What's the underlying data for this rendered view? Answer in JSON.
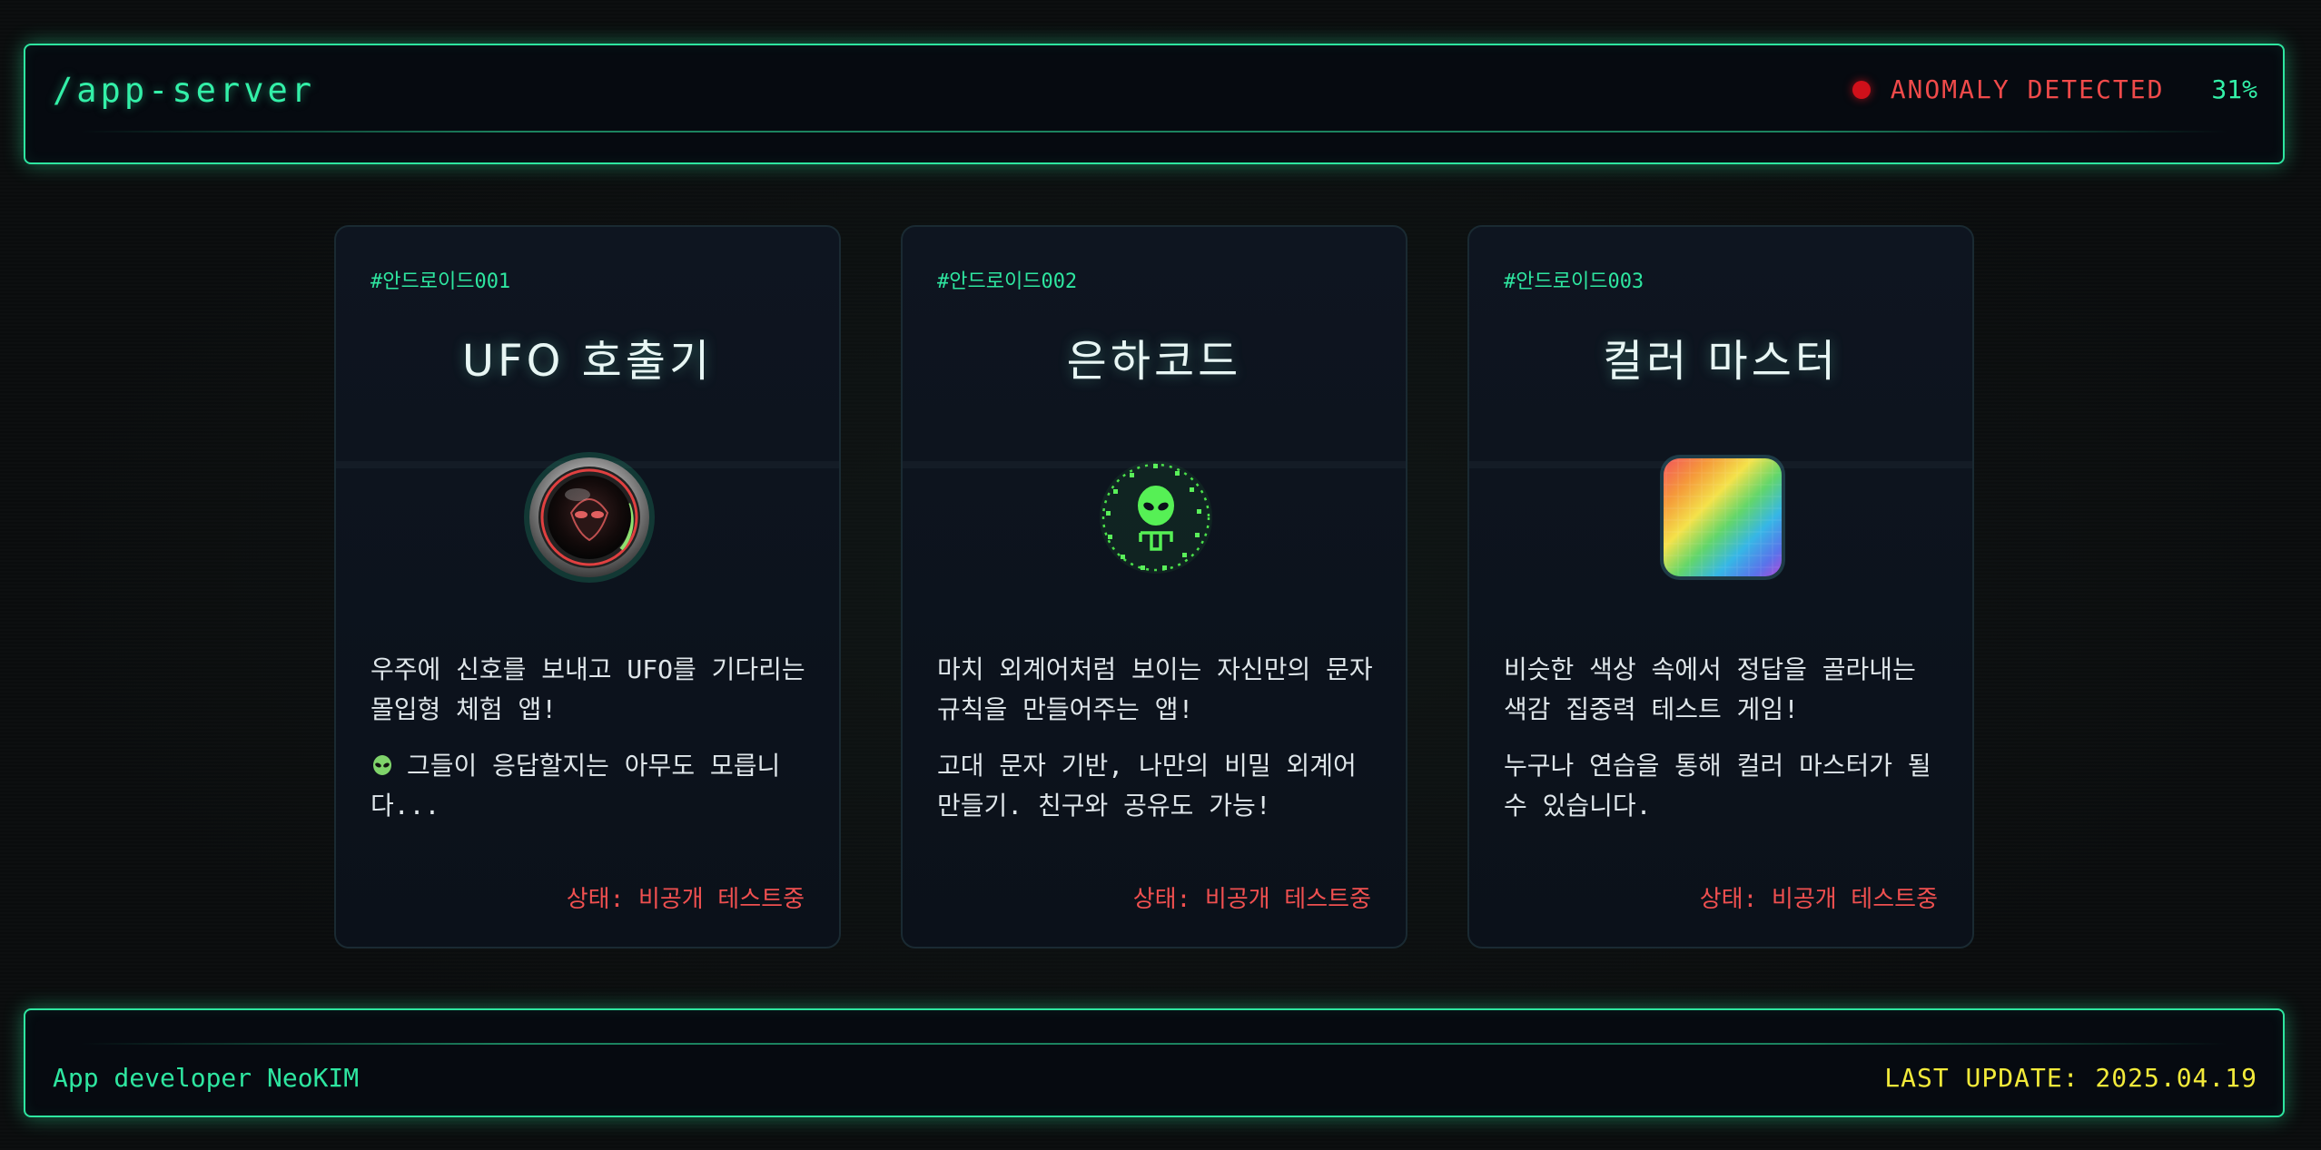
{
  "header": {
    "path": "/app-server",
    "anomaly_text": "ANOMALY DETECTED",
    "percent": "31%"
  },
  "cards": [
    {
      "id": "#안드로이드001",
      "title": "UFO 호출기",
      "icon": "ufo-lens-icon",
      "desc1": "우주에 신호를 보내고 UFO를 기다리는 몰입형 체험 앱!",
      "desc2": "그들이 응답할지는 아무도 모릅니다...",
      "status": "상태: 비공개 테스트중"
    },
    {
      "id": "#안드로이드002",
      "title": "은하코드",
      "icon": "alien-code-icon",
      "desc1": "마치 외계어처럼 보이는 자신만의 문자 규칙을 만들어주는 앱!",
      "desc2": "고대 문자 기반, 나만의 비밀 외계어 만들기. 친구와 공유도 가능!",
      "status": "상태: 비공개 테스트중"
    },
    {
      "id": "#안드로이드003",
      "title": "컬러 마스터",
      "icon": "color-grid-icon",
      "desc1": "비슷한 색상 속에서 정답을 골라내는 색감 집중력 테스트 게임!",
      "desc2": "누구나 연습을 통해 컬러 마스터가 될 수 있습니다.",
      "status": "상태: 비공개 테스트중"
    }
  ],
  "footer": {
    "developer": "App developer NeoKIM",
    "last_update": "LAST UPDATE: 2025.04.19"
  },
  "colors": {
    "accent": "#2ee6a0",
    "alert": "#f04a4a",
    "update": "#f2ea3a",
    "background": "#0a0c0d"
  }
}
